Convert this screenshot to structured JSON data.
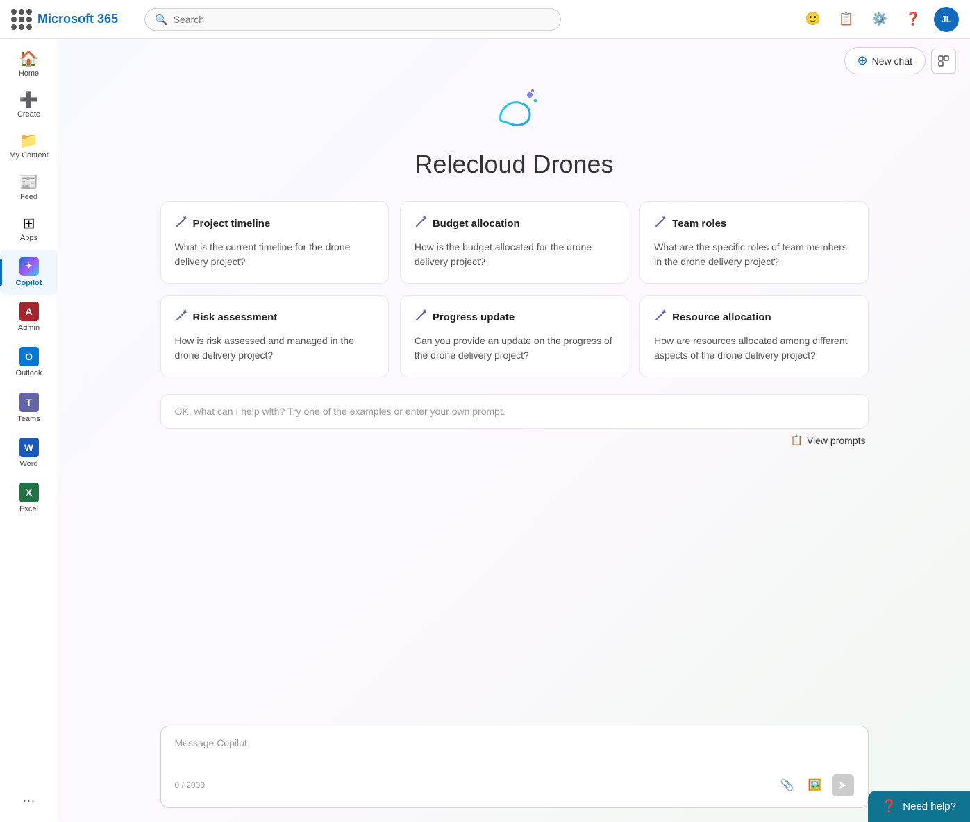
{
  "topbar": {
    "logo_text": "Microsoft 365",
    "search_placeholder": "Search",
    "user_initials": "JL"
  },
  "sidebar": {
    "items": [
      {
        "id": "home",
        "label": "Home",
        "icon": "🏠"
      },
      {
        "id": "create",
        "label": "Create",
        "icon": "➕"
      },
      {
        "id": "my-content",
        "label": "My Content",
        "icon": "📁"
      },
      {
        "id": "feed",
        "label": "Feed",
        "icon": "📰"
      },
      {
        "id": "apps",
        "label": "Apps",
        "icon": "⊞"
      },
      {
        "id": "copilot",
        "label": "Copilot",
        "icon": "✦"
      },
      {
        "id": "admin",
        "label": "Admin",
        "icon": "A"
      },
      {
        "id": "outlook",
        "label": "Outlook",
        "icon": "O"
      },
      {
        "id": "teams",
        "label": "Teams",
        "icon": "T"
      },
      {
        "id": "word",
        "label": "Word",
        "icon": "W"
      },
      {
        "id": "excel",
        "label": "Excel",
        "icon": "X"
      }
    ],
    "more_label": "···"
  },
  "header": {
    "new_chat_label": "New chat",
    "new_chat_icon": "⊕"
  },
  "hero": {
    "title": "Relecloud Drones"
  },
  "cards": [
    {
      "id": "project-timeline",
      "title": "Project timeline",
      "body": "What is the current timeline for the drone delivery project?"
    },
    {
      "id": "budget-allocation",
      "title": "Budget allocation",
      "body": "How is the budget allocated for the drone delivery project?"
    },
    {
      "id": "team-roles",
      "title": "Team roles",
      "body": "What are the specific roles of team members in the drone delivery project?"
    },
    {
      "id": "risk-assessment",
      "title": "Risk assessment",
      "body": "How is risk assessed and managed in the drone delivery project?"
    },
    {
      "id": "progress-update",
      "title": "Progress update",
      "body": "Can you provide an update on the progress of the drone delivery project?"
    },
    {
      "id": "resource-allocation",
      "title": "Resource allocation",
      "body": "How are resources allocated among different aspects of the drone delivery project?"
    }
  ],
  "input": {
    "hint": "OK, what can I help with? Try one of the examples or enter your own prompt.",
    "placeholder": "Message Copilot",
    "char_count": "0 / 2000"
  },
  "view_prompts": {
    "label": "View prompts",
    "icon": "📋"
  },
  "need_help": {
    "label": "Need help?",
    "icon": "?"
  }
}
